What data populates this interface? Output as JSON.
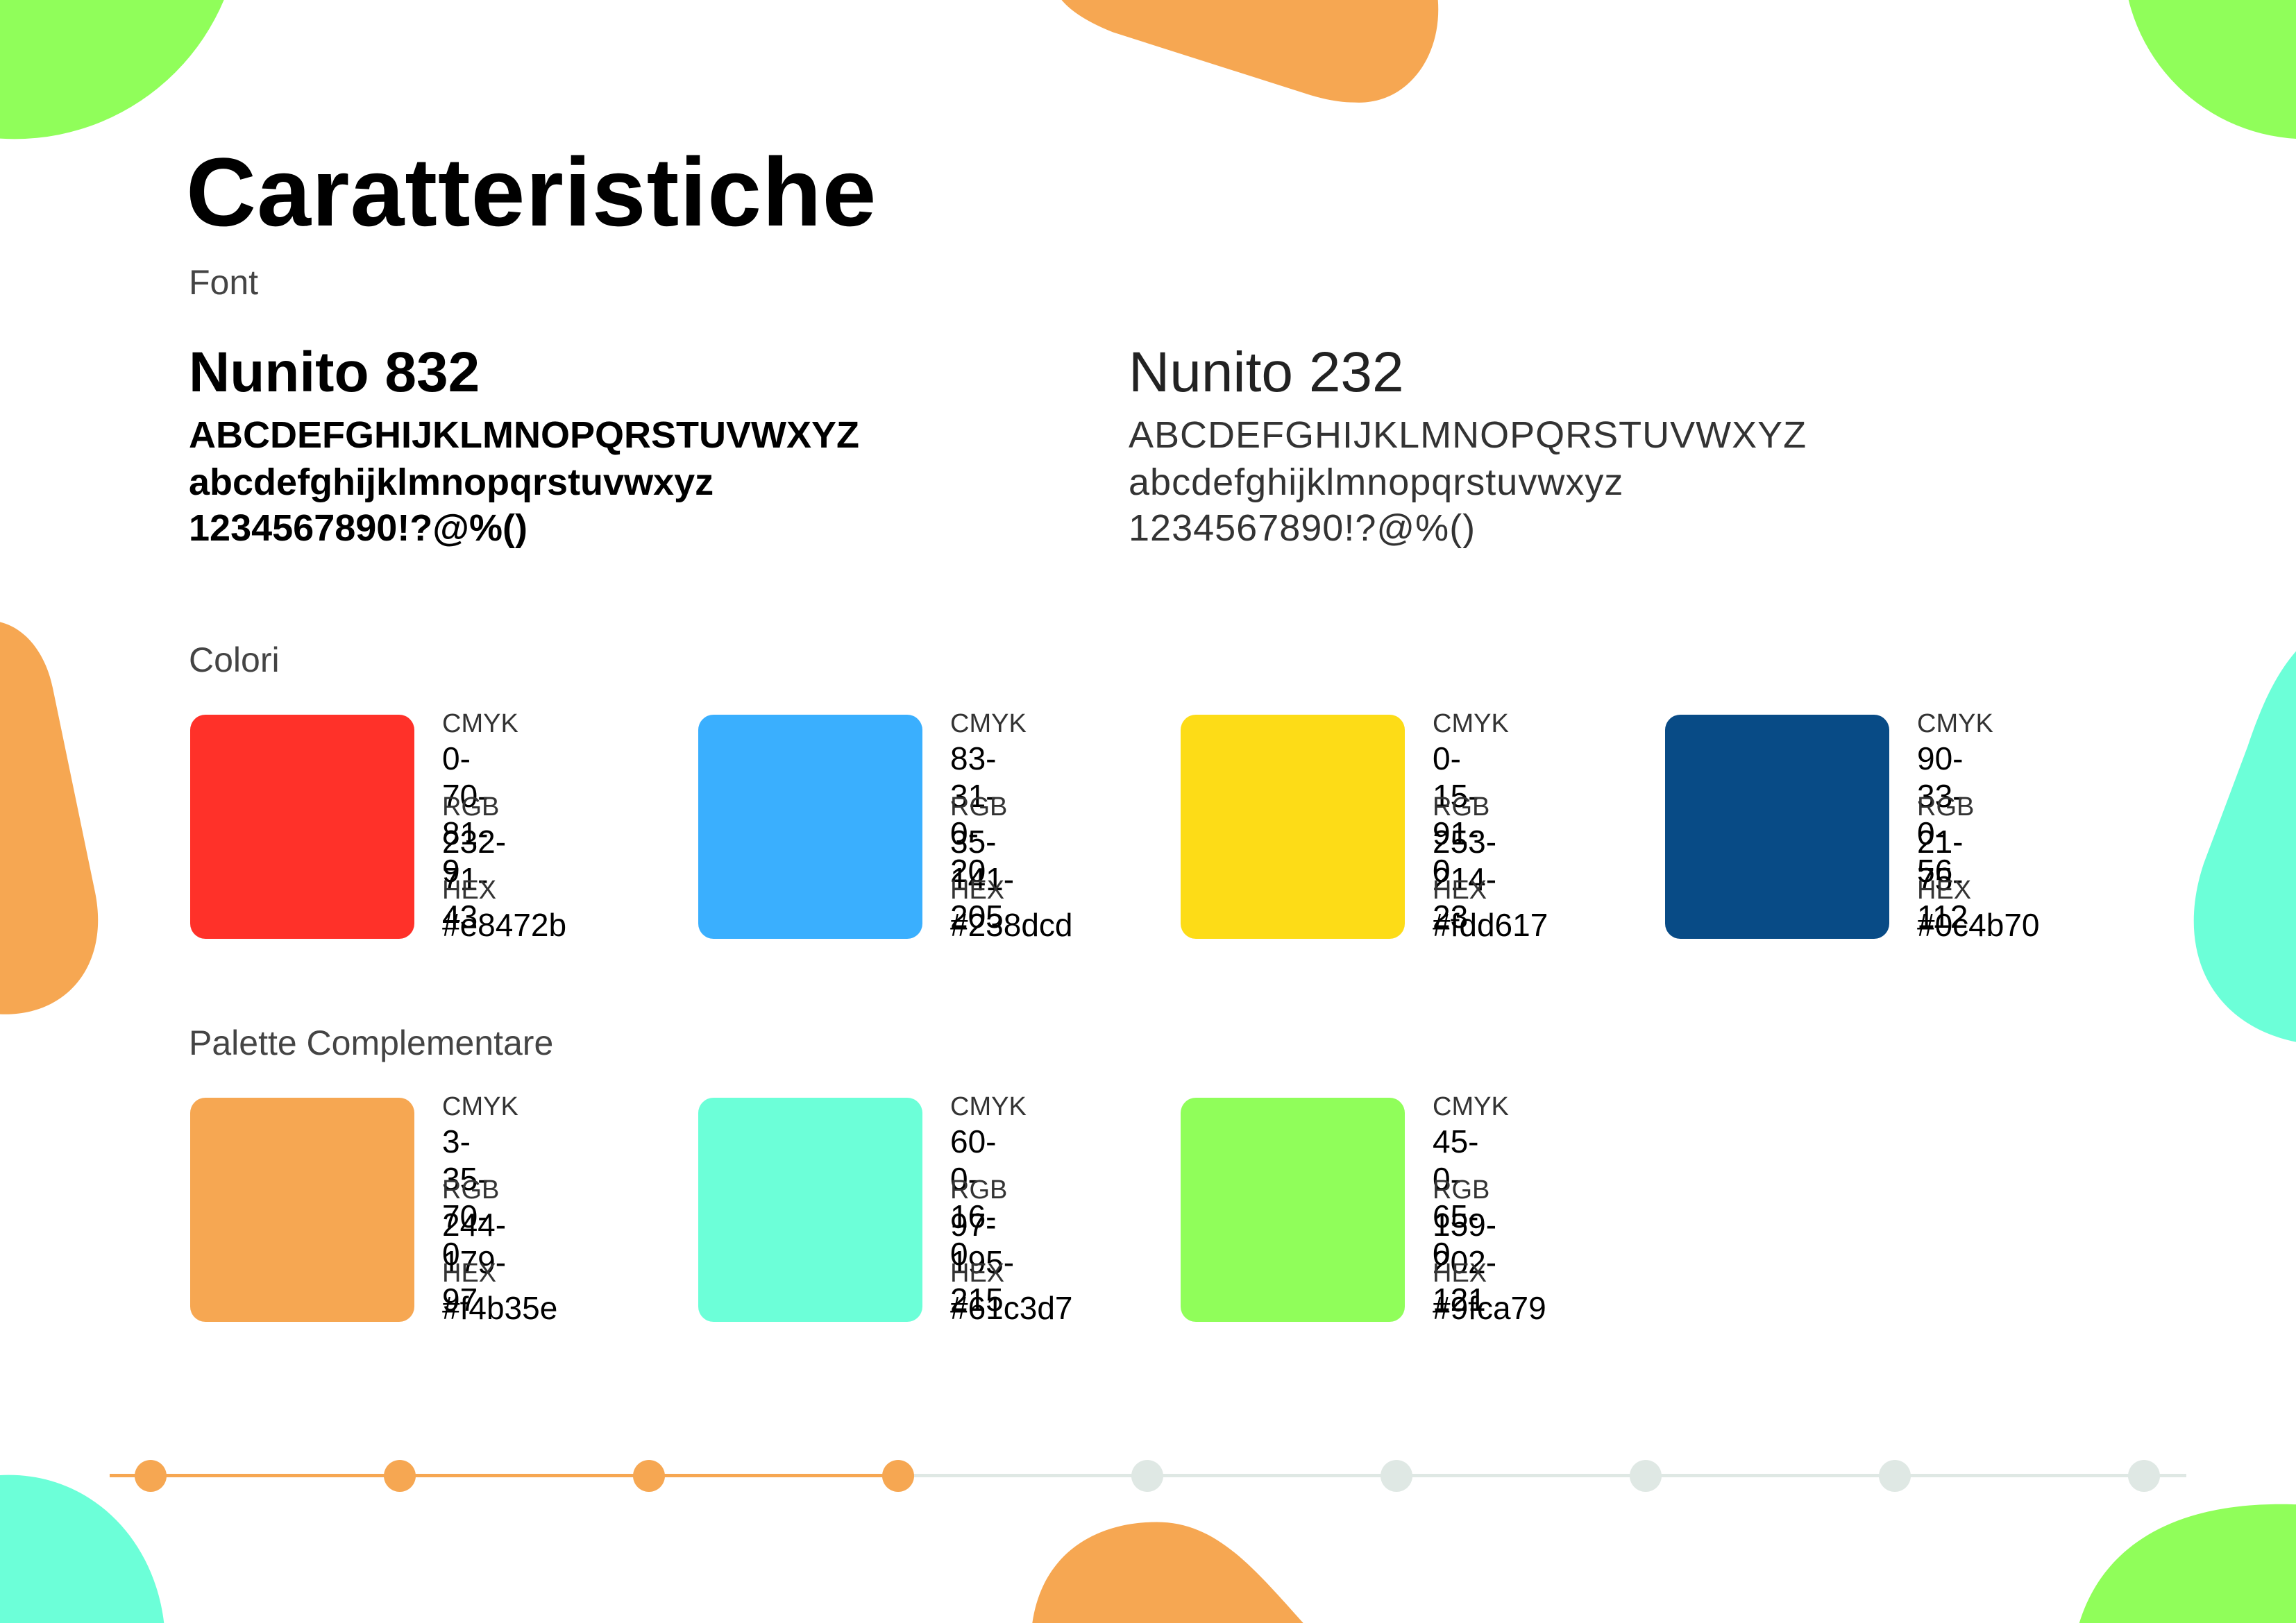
{
  "title": "Caratteristiche",
  "font_section": {
    "label": "Font",
    "bold": {
      "name": "Nunito 832",
      "upper": "ABCDEFGHIJKLMNOPQRSTUVWXYZ",
      "lower": "abcdefghijklmnopqrstuvwxyz",
      "digits": "1234567890!?@%()"
    },
    "light": {
      "name": "Nunito 232",
      "upper": "ABCDEFGHIJKLMNOPQRSTUVWXYZ",
      "lower": "abcdefghijklmnopqrstuvwxyz",
      "digits": "1234567890!?@%()"
    }
  },
  "colors_section": {
    "label": "Colori",
    "labels": {
      "cmyk": "CMYK",
      "rgb": "RGB",
      "hex": "HEX"
    },
    "items": [
      {
        "cmyk": "0-70-81-9",
        "rgb": "232-71-43",
        "hex": "#e8472b",
        "swatch": "#ff3129"
      },
      {
        "cmyk": "83-31-0-20",
        "rgb": "35-141-205",
        "hex": "#238dcd",
        "swatch": "#3aaffe"
      },
      {
        "cmyk": "0-15-91-0",
        "rgb": "253-214-23",
        "hex": "#fdd617",
        "swatch": "#fddc17"
      },
      {
        "cmyk": "90-33-0-56",
        "rgb": "21-75-112",
        "hex": "#0c4b70",
        "swatch": "#084b86"
      }
    ]
  },
  "palette_section": {
    "label": "Palette Complementare",
    "items": [
      {
        "cmyk": "3-35-70-0",
        "rgb": "244-179-97",
        "hex": "#f4b35e",
        "swatch": "#f6a752"
      },
      {
        "cmyk": "60-0-16-0",
        "rgb": "97-195-215",
        "hex": "#61c3d7",
        "swatch": "#6cffd8"
      },
      {
        "cmyk": "45-0-65-0",
        "rgb": "159-202-121",
        "hex": "#9fca79",
        "swatch": "#90fe5a"
      }
    ]
  },
  "progress": {
    "current_step": 4,
    "total_steps": 9,
    "active_color": "#f6a752",
    "inactive_color": "#dfe8e4"
  },
  "decor_colors": {
    "orange": "#f6a752",
    "green": "#90fe5a",
    "teal": "#6cffd8"
  }
}
